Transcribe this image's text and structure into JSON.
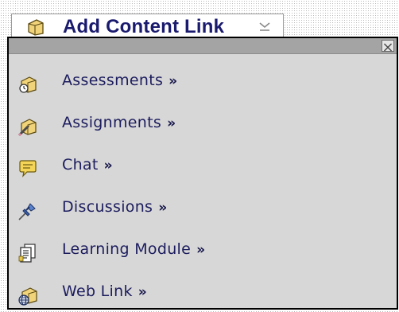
{
  "button": {
    "label": "Add Content Link",
    "icon": "page-icon",
    "chevron": "chevron-down-icon"
  },
  "panel": {
    "close_icon": "close-icon",
    "items": [
      {
        "label": "Assessments",
        "arrow": "»",
        "icon": "assessment-icon"
      },
      {
        "label": "Assignments",
        "arrow": "»",
        "icon": "assignment-icon"
      },
      {
        "label": "Chat",
        "arrow": "»",
        "icon": "chat-icon"
      },
      {
        "label": "Discussions",
        "arrow": "»",
        "icon": "pushpin-icon"
      },
      {
        "label": "Learning Module",
        "arrow": "»",
        "icon": "document-icon"
      },
      {
        "label": "Web Link",
        "arrow": "»",
        "icon": "web-link-icon"
      }
    ]
  },
  "colors": {
    "link_text": "#1c1c5e",
    "panel_bg": "#d7d7d7",
    "header_bar": "#a4a4a4"
  }
}
